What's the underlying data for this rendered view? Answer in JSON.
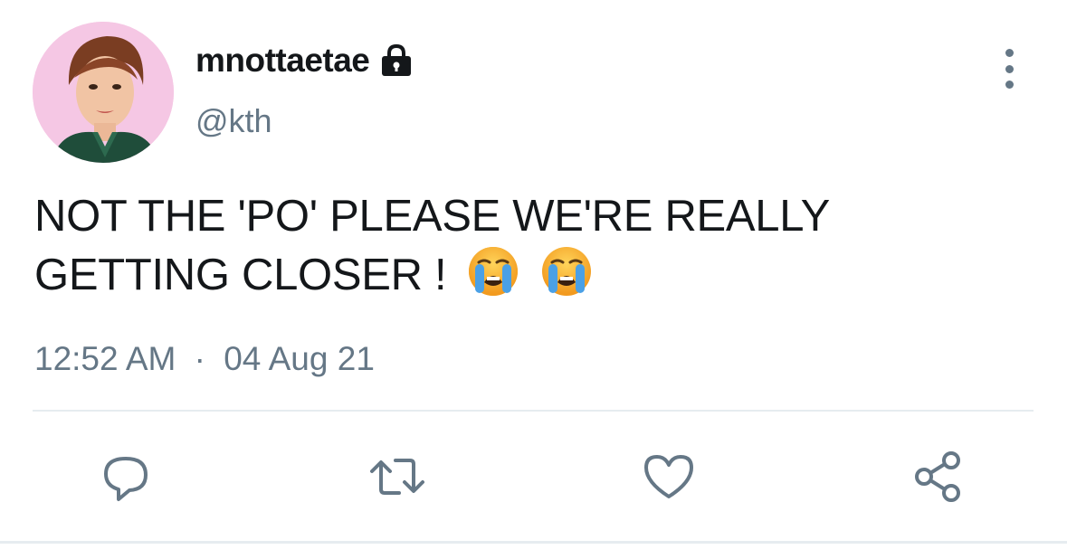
{
  "tweet": {
    "display_name": "mnottaetae",
    "handle": "@kth",
    "protected_icon": "lock-icon",
    "text_line1": "NOT THE 'PO' PLEASE WE'RE REALLY",
    "text_line2": "GETTING CLOSER !",
    "emojis": [
      "loudly-crying-face",
      "loudly-crying-face"
    ],
    "time": "12:52 AM",
    "separator": "·",
    "date": "04 Aug 21"
  },
  "actions": [
    {
      "icon": "reply-icon"
    },
    {
      "icon": "retweet-icon"
    },
    {
      "icon": "like-icon"
    },
    {
      "icon": "share-icon"
    }
  ],
  "colors": {
    "text": "#14171a",
    "secondary": "#657786",
    "divider": "#e6ecf0",
    "avatar_bg": "#f6c6e3"
  }
}
